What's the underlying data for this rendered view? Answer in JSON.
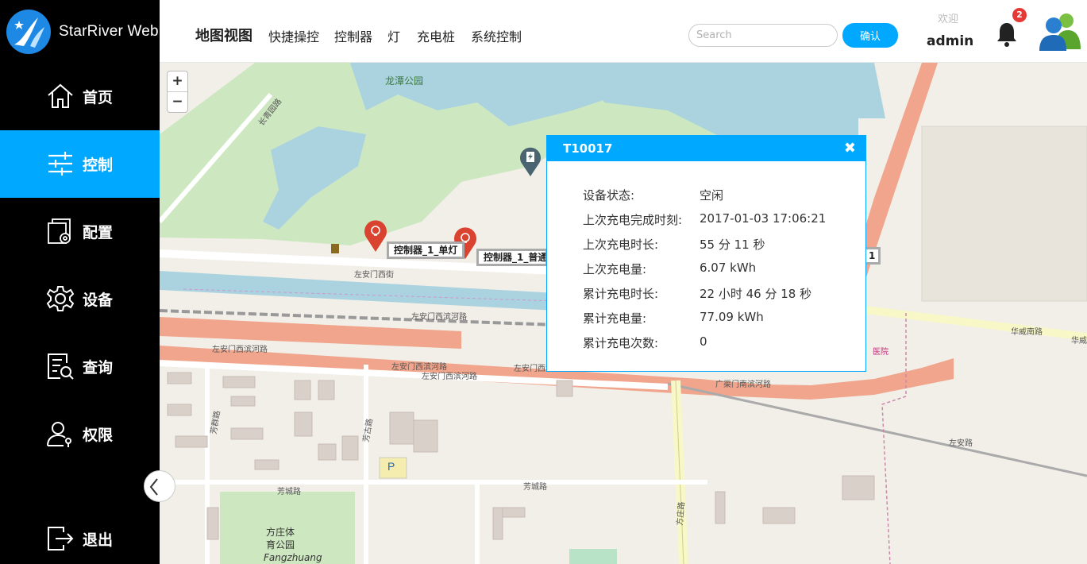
{
  "brand": {
    "name": "StarRiver Web"
  },
  "sidebar": {
    "items": [
      {
        "label": "首页",
        "icon": "home-icon"
      },
      {
        "label": "控制",
        "icon": "sliders-icon",
        "active": true
      },
      {
        "label": "配置",
        "icon": "config-icon"
      },
      {
        "label": "设备",
        "icon": "gear-icon"
      },
      {
        "label": "查询",
        "icon": "query-icon"
      },
      {
        "label": "权限",
        "icon": "user-permission-icon"
      },
      {
        "label": "退出",
        "icon": "logout-icon"
      }
    ]
  },
  "header": {
    "tabs": [
      {
        "label": "地图视图",
        "active": true
      },
      {
        "label": "快捷操控"
      },
      {
        "label": "控制器"
      },
      {
        "label": "灯"
      },
      {
        "label": "充电桩"
      },
      {
        "label": "系统控制"
      }
    ],
    "search": {
      "placeholder": "Search",
      "value": ""
    },
    "confirm_label": "确认",
    "welcome": "欢迎",
    "user": "admin",
    "notification_count": "2"
  },
  "map": {
    "zoom_in": "+",
    "zoom_out": "−",
    "labels": {
      "park": "龙潭公园",
      "xiannong_rd": "长青园路",
      "west_street": "左安门西街",
      "canal_rd_1": "左安门西滨河路",
      "canal_rd_2": "左安门西滨河路",
      "canal_rd_3": "左安门西滨河路",
      "canal_rd_4": "左安门西滨河路",
      "canal_rd_5": "左安门西滨河路",
      "guangqu_rd": "广渠门南滨河路",
      "huawei_rd": "华威南路",
      "huawei_rd_2": "华威",
      "zuoan_rd": "左安路",
      "fangcheng_rd_1": "芳城路",
      "fangcheng_rd_2": "芳城路",
      "fangqun_rd": "芳群路",
      "fanggu_rd": "芳古路",
      "fangzhuang_park_1": "方庄体",
      "fangzhuang_park_2": "育公园",
      "fangzhuang_en": "Fangzhuang",
      "fangzhuang_rd": "方庄路",
      "hospital": "医院",
      "parking": "P"
    },
    "controllers": [
      {
        "label": "控制器_1_单灯"
      },
      {
        "label": "控制器_1_普通"
      }
    ],
    "partial_marker_label": "1"
  },
  "popup": {
    "title": "T10017",
    "close": "✖",
    "rows": [
      {
        "label": "设备状态:",
        "value": "空闲"
      },
      {
        "label": "上次充电完成时刻:",
        "value": "2017-01-03 17:06:21"
      },
      {
        "label": "上次充电时长:",
        "value": "55 分 11 秒"
      },
      {
        "label": "上次充电量:",
        "value": "6.07 kWh"
      },
      {
        "label": "累计充电时长:",
        "value": "22 小时 46 分 18 秒"
      },
      {
        "label": "累计充电量:",
        "value": "77.09 kWh"
      },
      {
        "label": "累计充电次数:",
        "value": "0"
      }
    ]
  },
  "colors": {
    "accent": "#00a8ff",
    "badge": "#e53935",
    "marker": "#d9432f",
    "road_main": "#f0a58c",
    "park": "#cde8c0",
    "water": "#aad3df"
  }
}
